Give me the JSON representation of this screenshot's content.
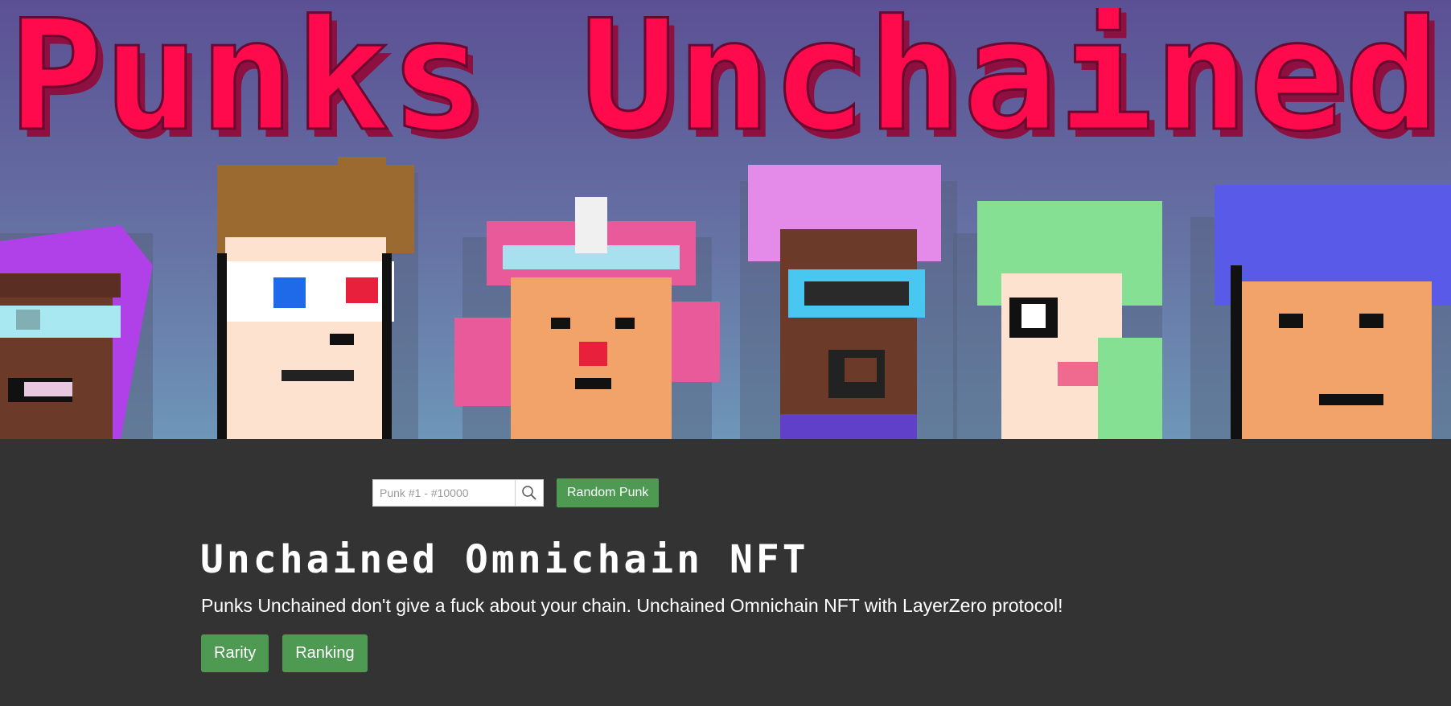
{
  "hero": {
    "title": "Punks Unchained",
    "colors": {
      "title_fill": "#ff0a4d",
      "title_shadow": "#8e1040",
      "bg_top": "#5b5094",
      "bg_bottom": "#6e96b8"
    }
  },
  "search": {
    "placeholder": "Punk #1 - #10000",
    "icon": "search-icon"
  },
  "random_button": {
    "label": "Random Punk"
  },
  "heading": "Unchained Omnichain NFT",
  "description": "Punks Unchained don't give a fuck about your chain. Unchained Omnichain NFT with LayerZero protocol!",
  "buttons": {
    "rarity": "Rarity",
    "ranking": "Ranking"
  },
  "colors": {
    "page_bg": "#333333",
    "accent": "#4e9a53"
  }
}
